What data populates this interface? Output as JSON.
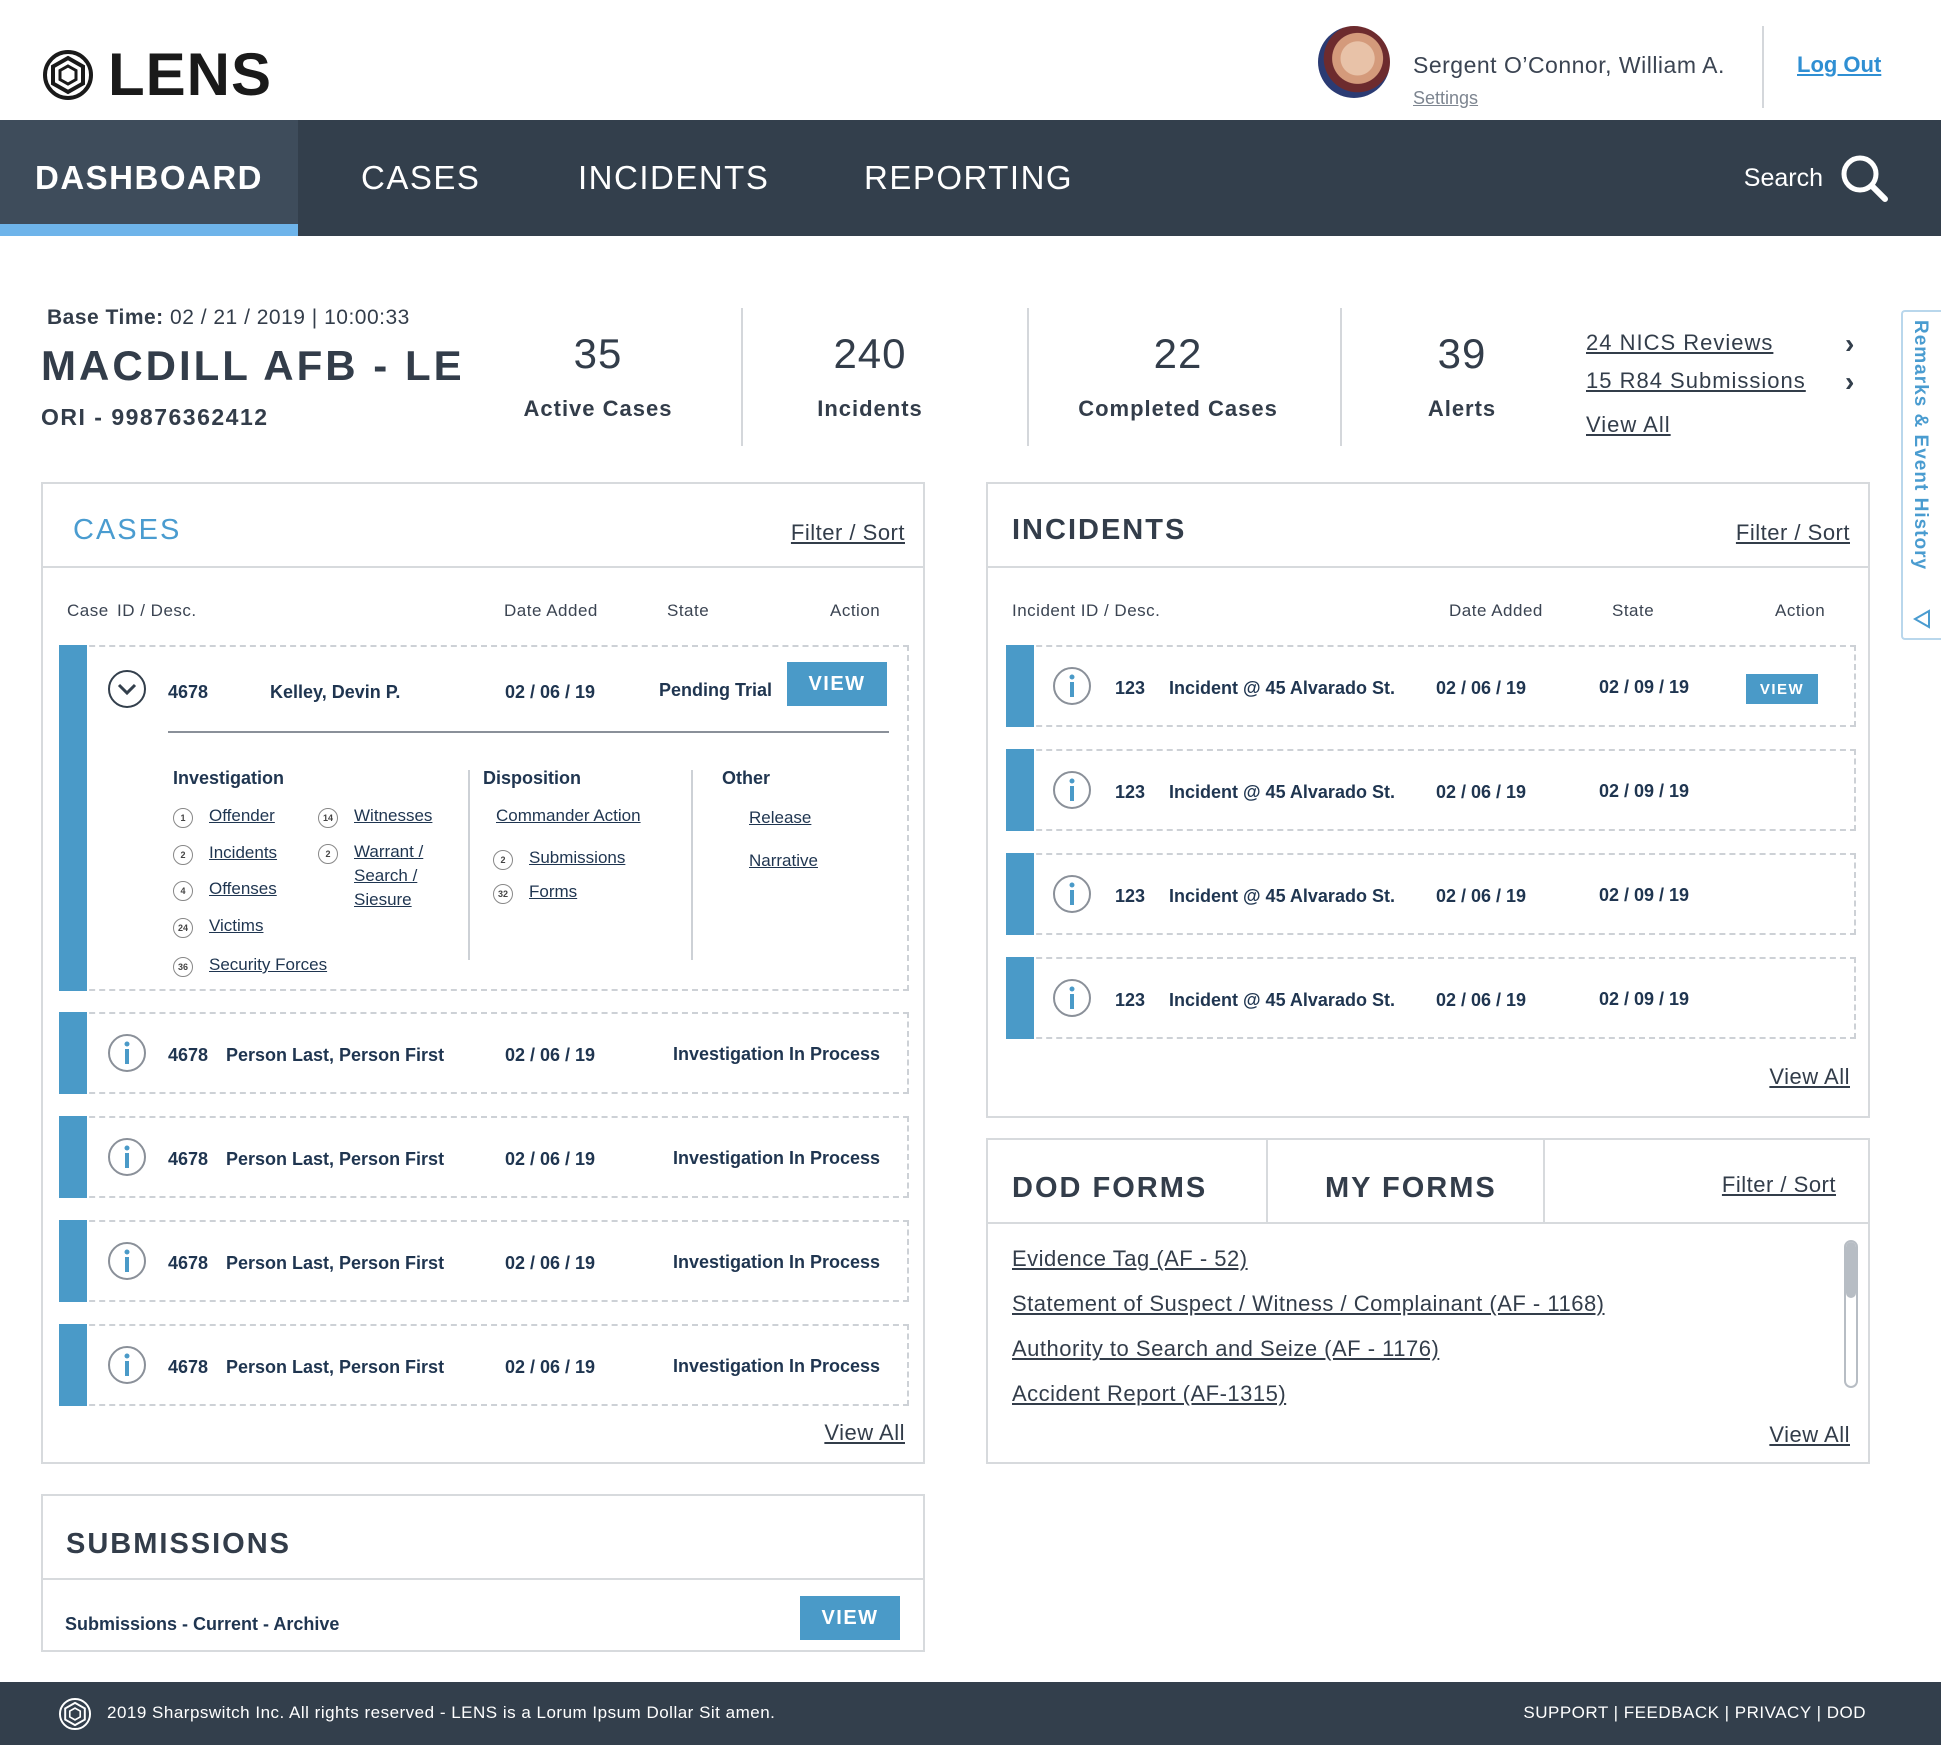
{
  "header": {
    "logo_text": "LENS",
    "user_name": "Sergent O’Connor, William A.",
    "settings_label": "Settings",
    "logout_label": "Log Out"
  },
  "nav": {
    "items": [
      {
        "label": "DASHBOARD"
      },
      {
        "label": "CASES"
      },
      {
        "label": "INCIDENTS"
      },
      {
        "label": "REPORTING"
      }
    ],
    "search_label": "Search"
  },
  "summary": {
    "base_time_label": "Base Time:",
    "base_time_value": "02 / 21 / 2019 | 10:00:33",
    "base_name": "MACDILL AFB - LE",
    "ori": "ORI - 99876362412",
    "stats": [
      {
        "value": "35",
        "label": "Active Cases"
      },
      {
        "value": "240",
        "label": "Incidents"
      },
      {
        "value": "22",
        "label": "Completed Cases"
      },
      {
        "value": "39",
        "label": "Alerts"
      }
    ],
    "links": {
      "nics": "24 NICS Reviews",
      "r84": "15 R84 Submissions",
      "view_all": "View All"
    }
  },
  "side_tab": {
    "label": "Remarks & Event History"
  },
  "cases": {
    "title": "CASES",
    "filter_label": "Filter / Sort",
    "columns": {
      "case_label": "Case",
      "id_label": "ID / Desc.",
      "date": "Date Added",
      "state": "State",
      "action": "Action"
    },
    "expanded": {
      "id": "4678",
      "name": "Kelley, Devin P.",
      "date": "02 / 06 / 19",
      "state": "Pending Trial",
      "button": "VIEW",
      "investigation": {
        "title": "Investigation",
        "col1": [
          {
            "count": "1",
            "label": "Offender"
          },
          {
            "count": "2",
            "label": "Incidents"
          },
          {
            "count": "4",
            "label": "Offenses"
          },
          {
            "count": "24",
            "label": "Victims"
          },
          {
            "count": "36",
            "label": "Security Forces"
          }
        ],
        "col2": [
          {
            "count": "14",
            "label": "Witnesses"
          },
          {
            "count": "2",
            "label_line1": "Warrant /",
            "label_line2": "Search /",
            "label_line3": "Siesure"
          }
        ]
      },
      "disposition": {
        "title": "Disposition",
        "items": [
          {
            "label": "Commander Action"
          },
          {
            "count": "2",
            "label": "Submissions"
          },
          {
            "count": "32",
            "label": "Forms"
          }
        ]
      },
      "other": {
        "title": "Other",
        "items": [
          {
            "label": "Release"
          },
          {
            "label": "Narrative"
          }
        ]
      }
    },
    "rows": [
      {
        "id": "4678",
        "name": "Person Last, Person First",
        "date": "02 / 06 / 19",
        "state": "Investigation In Process"
      },
      {
        "id": "4678",
        "name": "Person Last, Person First",
        "date": "02 / 06 / 19",
        "state": "Investigation In Process"
      },
      {
        "id": "4678",
        "name": "Person Last, Person First",
        "date": "02 / 06 / 19",
        "state": "Investigation In Process"
      },
      {
        "id": "4678",
        "name": "Person Last, Person First",
        "date": "02 / 06 / 19",
        "state": "Investigation In Process"
      }
    ],
    "view_all": "View All"
  },
  "incidents": {
    "title": "INCIDENTS",
    "filter_label": "Filter / Sort",
    "columns": {
      "id": "Incident ID / Desc.",
      "date": "Date Added",
      "state": "State",
      "action": "Action"
    },
    "rows": [
      {
        "id": "123",
        "desc": "Incident @ 45 Alvarado St.",
        "date": "02 / 06 / 19",
        "state": "02 / 09 / 19",
        "button": "VIEW"
      },
      {
        "id": "123",
        "desc": "Incident @ 45 Alvarado St.",
        "date": "02 / 06 / 19",
        "state": "02 / 09 / 19"
      },
      {
        "id": "123",
        "desc": "Incident @ 45 Alvarado St.",
        "date": "02 / 06 / 19",
        "state": "02 / 09 / 19"
      },
      {
        "id": "123",
        "desc": "Incident @ 45 Alvarado St.",
        "date": "02 / 06 / 19",
        "state": "02 / 09 / 19"
      }
    ],
    "view_all": "View All"
  },
  "forms": {
    "tab1": "DOD FORMS",
    "tab2": "MY FORMS",
    "filter_label": "Filter / Sort",
    "items": [
      "Evidence Tag (AF - 52)",
      "Statement of Suspect / Witness / Complainant (AF - 1168)",
      "Authority to Search and Seize (AF - 1176)",
      "Accident Report (AF-1315)"
    ],
    "view_all": "View All"
  },
  "submissions": {
    "title": "SUBMISSIONS",
    "label": "Submissions - Current - Archive",
    "button": "VIEW"
  },
  "footer": {
    "text": "2019 Sharpswitch Inc. All rights reserved - LENS is a Lorum Ipsum Dollar Sit amen.",
    "links": "SUPPORT | FEEDBACK | PRIVACY | DOD"
  },
  "colors": {
    "nav_bg": "#333f4c",
    "accent_blue": "#4a9ac8",
    "active_underline": "#6eb4ea",
    "logout_blue": "#2f8fd3"
  }
}
